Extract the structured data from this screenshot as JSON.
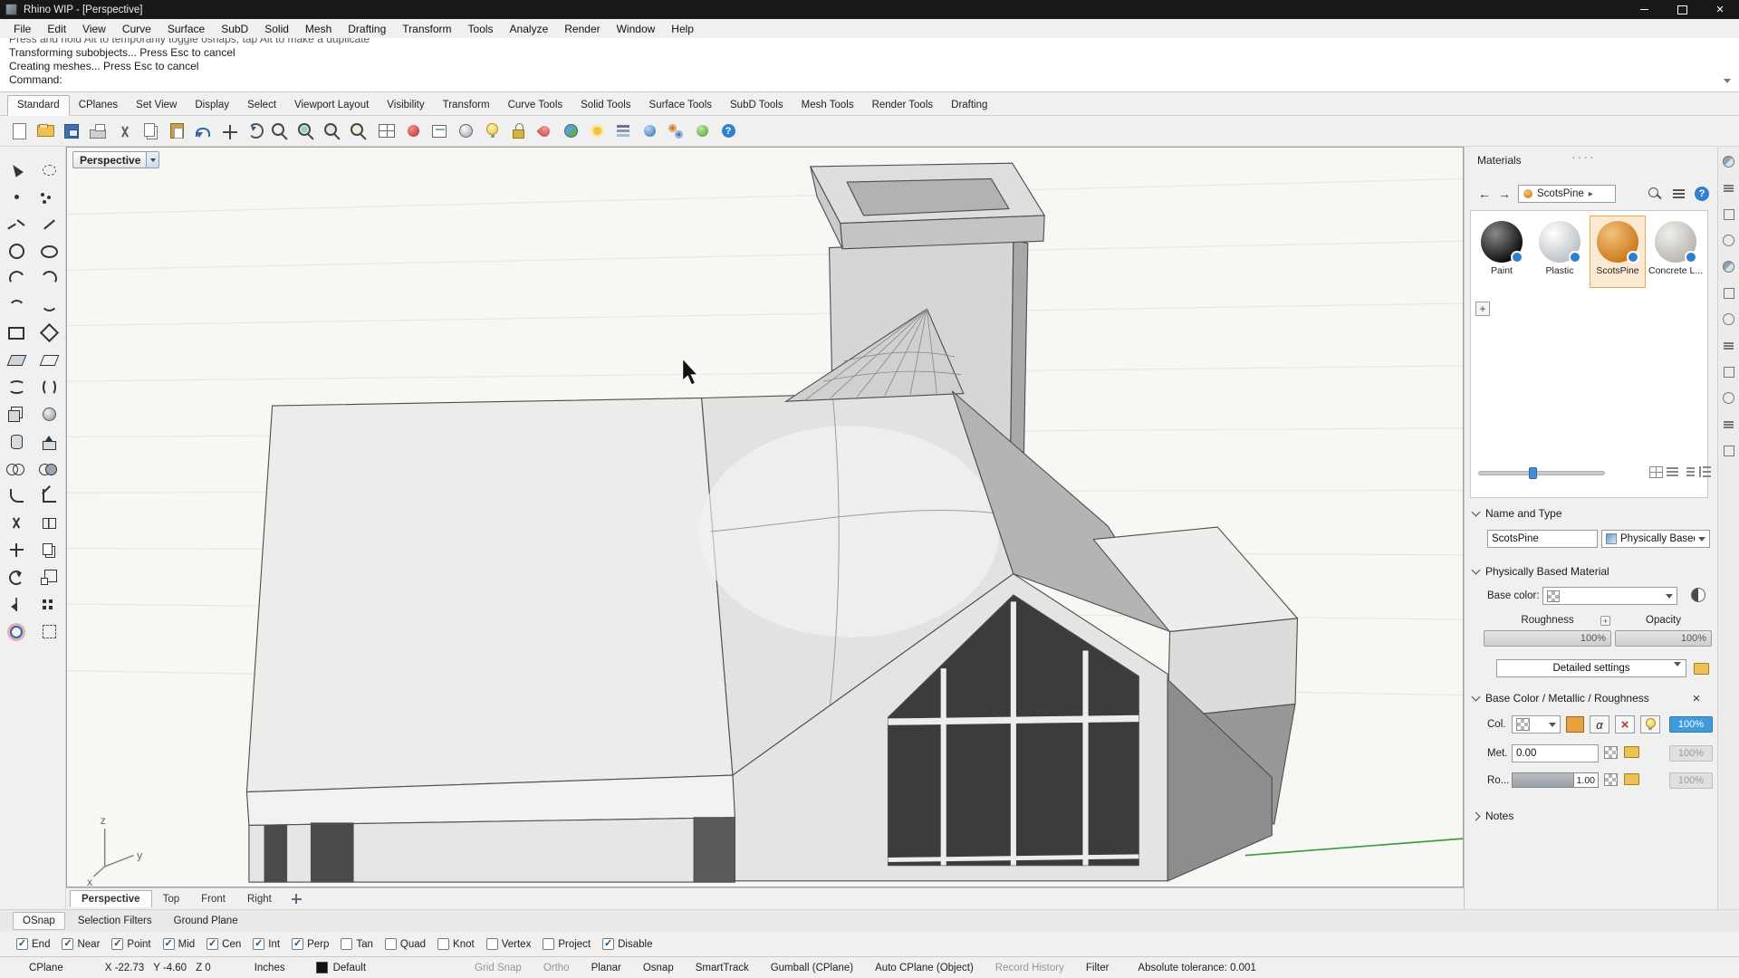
{
  "window": {
    "title": "Rhino WIP - [Perspective]"
  },
  "menu": {
    "items": [
      "File",
      "Edit",
      "View",
      "Curve",
      "Surface",
      "SubD",
      "Solid",
      "Mesh",
      "Drafting",
      "Transform",
      "Tools",
      "Analyze",
      "Render",
      "Window",
      "Help"
    ]
  },
  "command": {
    "history": [
      "Press and hold Alt to temporarily toggle osnaps; tap Alt to make a duplicate",
      "Transforming subobjects... Press Esc to cancel",
      "Creating meshes... Press Esc to cancel"
    ],
    "prompt": "Command:"
  },
  "tabs": {
    "items": [
      "Standard",
      "CPlanes",
      "Set View",
      "Display",
      "Select",
      "Viewport Layout",
      "Visibility",
      "Transform",
      "Curve Tools",
      "Solid Tools",
      "Surface Tools",
      "SubD Tools",
      "Mesh Tools",
      "Render Tools",
      "Drafting"
    ],
    "active": "Standard"
  },
  "toolbar_icons": [
    "new-file",
    "open-file",
    "save-file",
    "print",
    "cut",
    "copy",
    "paste",
    "undo",
    "pan-view",
    "rotate-view",
    "zoom-dynamic",
    "zoom-window",
    "zoom-extents",
    "zoom-selected",
    "viewport-layout",
    "set-cplane",
    "named-view",
    "shade-view",
    "light",
    "lock",
    "render-material",
    "render-environment",
    "sun-study",
    "layers",
    "render",
    "options",
    "grasshopper",
    "help"
  ],
  "sidebar_icons": [
    "select",
    "lasso",
    "point",
    "point-cloud",
    "polyline",
    "line",
    "circle",
    "ellipse",
    "arc",
    "conic",
    "curve",
    "handle-curve",
    "rectangle",
    "polygon",
    "plane",
    "surface-3pt",
    "loft",
    "sweep",
    "box",
    "sphere",
    "cylinder",
    "extrude",
    "boolean-union",
    "boolean-difference",
    "fillet",
    "chamfer",
    "trim",
    "split",
    "move",
    "copy-object",
    "rotate",
    "scale",
    "mirror",
    "array",
    "gumball",
    "cage-edit"
  ],
  "viewport": {
    "label": "Perspective",
    "tabs": [
      "Perspective",
      "Top",
      "Front",
      "Right"
    ],
    "active_tab": "Perspective",
    "axis": {
      "x": "x",
      "y": "y",
      "z": "z"
    }
  },
  "bottom": {
    "tabs": [
      "OSnap",
      "Selection Filters",
      "Ground Plane"
    ],
    "osnap": [
      {
        "label": "End",
        "mark": "✓"
      },
      {
        "label": "Near",
        "mark": "✓"
      },
      {
        "label": "Point",
        "mark": "✓"
      },
      {
        "label": "Mid",
        "mark": "✓"
      },
      {
        "label": "Cen",
        "mark": "✓"
      },
      {
        "label": "Int",
        "mark": "✓"
      },
      {
        "label": "Perp",
        "mark": "✓"
      },
      {
        "label": "Tan",
        "mark": ""
      },
      {
        "label": "Quad",
        "mark": ""
      },
      {
        "label": "Knot",
        "mark": ""
      },
      {
        "label": "Vertex",
        "mark": ""
      },
      {
        "label": "Project",
        "mark": ""
      },
      {
        "label": "Disable",
        "mark": "✓"
      }
    ]
  },
  "status": {
    "cplane": "CPlane",
    "x": "X -22.73",
    "y": "Y -4.60",
    "z": "Z 0",
    "units": "Inches",
    "layer": "Default",
    "items": [
      {
        "label": "Grid Snap",
        "active": false
      },
      {
        "label": "Ortho",
        "active": false
      },
      {
        "label": "Planar",
        "active": true
      },
      {
        "label": "Osnap",
        "active": true
      },
      {
        "label": "SmartTrack",
        "active": true
      },
      {
        "label": "Gumball (CPlane)",
        "active": true
      },
      {
        "label": "Auto CPlane (Object)",
        "active": true
      },
      {
        "label": "Record History",
        "active": false
      },
      {
        "label": "Filter",
        "active": true
      }
    ],
    "tolerance": "Absolute tolerance: 0.001"
  },
  "materials": {
    "title": "Materials",
    "dots": "····",
    "breadcrumb": "ScotsPine",
    "items": [
      {
        "name": "Paint",
        "selected": false
      },
      {
        "name": "Plastic",
        "selected": false
      },
      {
        "name": "ScotsPine",
        "selected": true
      },
      {
        "name": "Concrete L...",
        "selected": false
      }
    ],
    "name_type": {
      "header": "Name and Type",
      "name": "ScotsPine",
      "type": "Physically Based"
    },
    "pbm": {
      "header": "Physically Based Material",
      "base_color": "Base color:",
      "roughness": "Roughness",
      "roughness_value": "100%",
      "opacity": "Opacity",
      "opacity_value": "100%",
      "detailed": "Detailed settings"
    },
    "bcmr": {
      "header": "Base Color /  Metallic / Roughness",
      "col": "Col.",
      "col_pct": "100%",
      "met": "Met.",
      "met_value": "0.00",
      "met_pct": "100%",
      "ro": "Ro...",
      "ro_value": "1.00",
      "ro_pct": "100%"
    },
    "notes": {
      "header": "Notes"
    }
  },
  "panel_view_icons": [
    "thumbnail-view",
    "list-view",
    "detail-view",
    "tree-view"
  ],
  "strip_icons": [
    "properties",
    "layers",
    "display",
    "materials",
    "environments",
    "rendering",
    "sun",
    "libraries",
    "notes",
    "help",
    "web",
    "history"
  ],
  "colors": {
    "accent_blue": "#3f9bdc",
    "selection_orange": "#eba64a",
    "material_orange": "#c97718",
    "help_blue": "#2f80d0",
    "green_axis": "#3f9d3f"
  }
}
